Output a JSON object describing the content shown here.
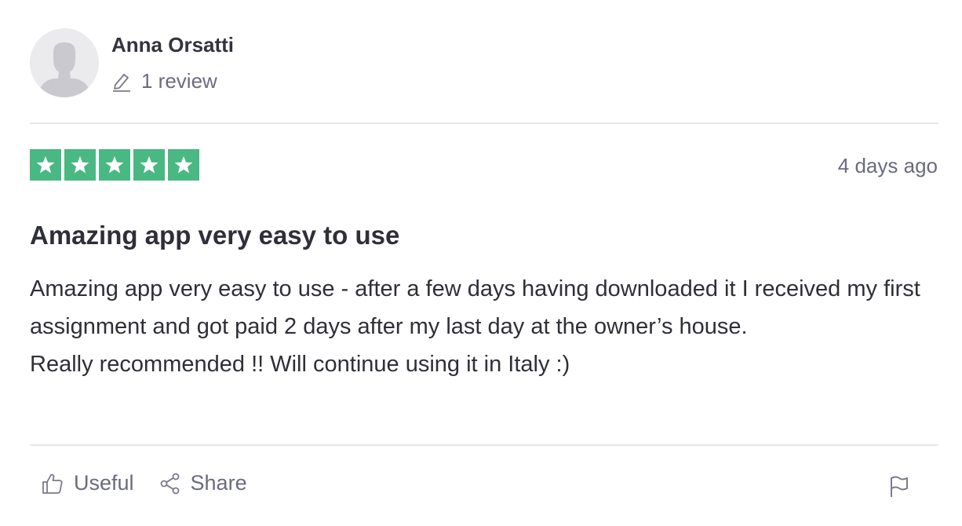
{
  "reviewer": {
    "name": "Anna Orsatti",
    "review_count": "1 review",
    "avatar_icon": "user-silhouette-icon",
    "review_icon": "pencil-icon"
  },
  "review": {
    "rating": 5,
    "rating_max": 5,
    "date": "4 days ago",
    "title": "Amazing app very easy to use",
    "body": [
      "Amazing app very easy to use - after a few days having downloaded it I received my first assignment and got paid 2 days after my last day at the owner’s house.",
      "Really recommended !! Will continue using it in Italy :)"
    ]
  },
  "actions": {
    "useful_label": "Useful",
    "useful_icon": "thumbs-up-icon",
    "share_label": "Share",
    "share_icon": "share-icon",
    "report_icon": "flag-icon"
  },
  "colors": {
    "star_background": "#49b882",
    "text_primary": "#2f2f37",
    "text_secondary": "#6b6b80",
    "divider": "#e7e7ea"
  }
}
